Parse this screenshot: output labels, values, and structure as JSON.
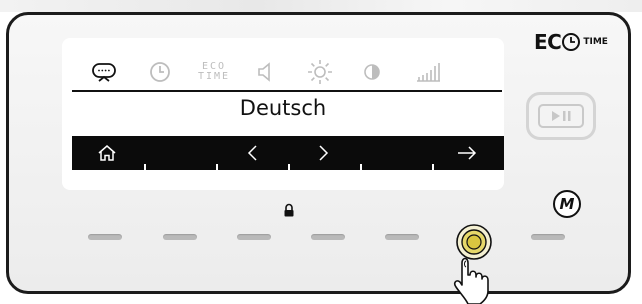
{
  "display": {
    "menu_icons": [
      "speech-bubble",
      "clock",
      "eco-time",
      "speaker",
      "brightness",
      "contrast",
      "signal-bars"
    ],
    "eco_time_label": "ECO TIME",
    "eco_time_line1": "ECO",
    "eco_time_line2": "TIME",
    "selected_value": "Deutsch",
    "nav_buttons": [
      "home",
      "previous",
      "next",
      "enter"
    ]
  },
  "brand": {
    "logo_main": "EC",
    "logo_suffix": "TIME"
  },
  "buttons": {
    "play_pause": "play-pause",
    "manual": "M"
  },
  "colors": {
    "frame": "#1b1b1b",
    "navbar": "#0b0b0b",
    "led_off": "#b9b9b9",
    "knob_active": "#d9c640"
  }
}
